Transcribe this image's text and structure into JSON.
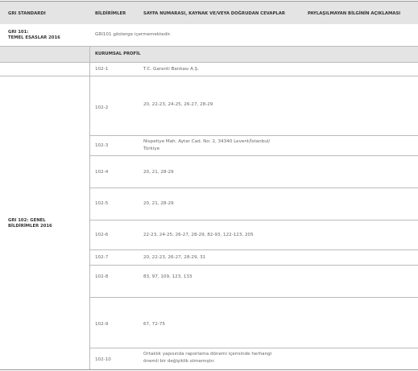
{
  "header": {
    "col1": "GRI STANDARDI",
    "col2": "BİLDİRİMLER",
    "col3": "SAYFA NUMARASI, KAYNAK VE/VEYA DOĞRUDAN CEVAPLAR",
    "col4": "PAYLAŞILMAYAN BİLGİNİN AÇIKLAMASI"
  },
  "gri101": {
    "standard_line1": "GRI 101:",
    "standard_line2": "TEMEL ESASLAR 2016",
    "note": "GRI101 gösterge içermemektedir."
  },
  "section": {
    "title": "KURUMSAL PROFİL"
  },
  "gri102": {
    "standard_line1": "GRI 102: GENEL",
    "standard_line2": "BİLDİRİMLER 2016"
  },
  "rows": [
    {
      "code": "102-1",
      "value": "T.C. Garanti Bankası A.Ş."
    },
    {
      "code": "102-2",
      "value": "20, 22-23, 24-25, 26-27, 28-29"
    },
    {
      "code": "102-3",
      "value": "Nispetiye Mah. Aytar Cad. No: 2, 34340 Levent/İstanbul/",
      "value2": "Türkiye"
    },
    {
      "code": "102-4",
      "value": "20, 21, 28-29"
    },
    {
      "code": "102-5",
      "value": "20, 21, 28-29"
    },
    {
      "code": "102-6",
      "value": "22-23, 24-25, 26-27, 28-29, 82-93, 122-123, 205"
    },
    {
      "code": "102-7",
      "value": "20, 22-23, 26-27, 28-29, 31"
    },
    {
      "code": "102-8",
      "value": "83, 97, 109, 123, 133"
    },
    {
      "code": "102-9",
      "value": "67, 72-75"
    },
    {
      "code": "102-10",
      "value": "Ortaklık yapısında raporlama dönemi içerisinde herhangi",
      "value2": "önemli bir değişiklik olmamıştır."
    }
  ]
}
